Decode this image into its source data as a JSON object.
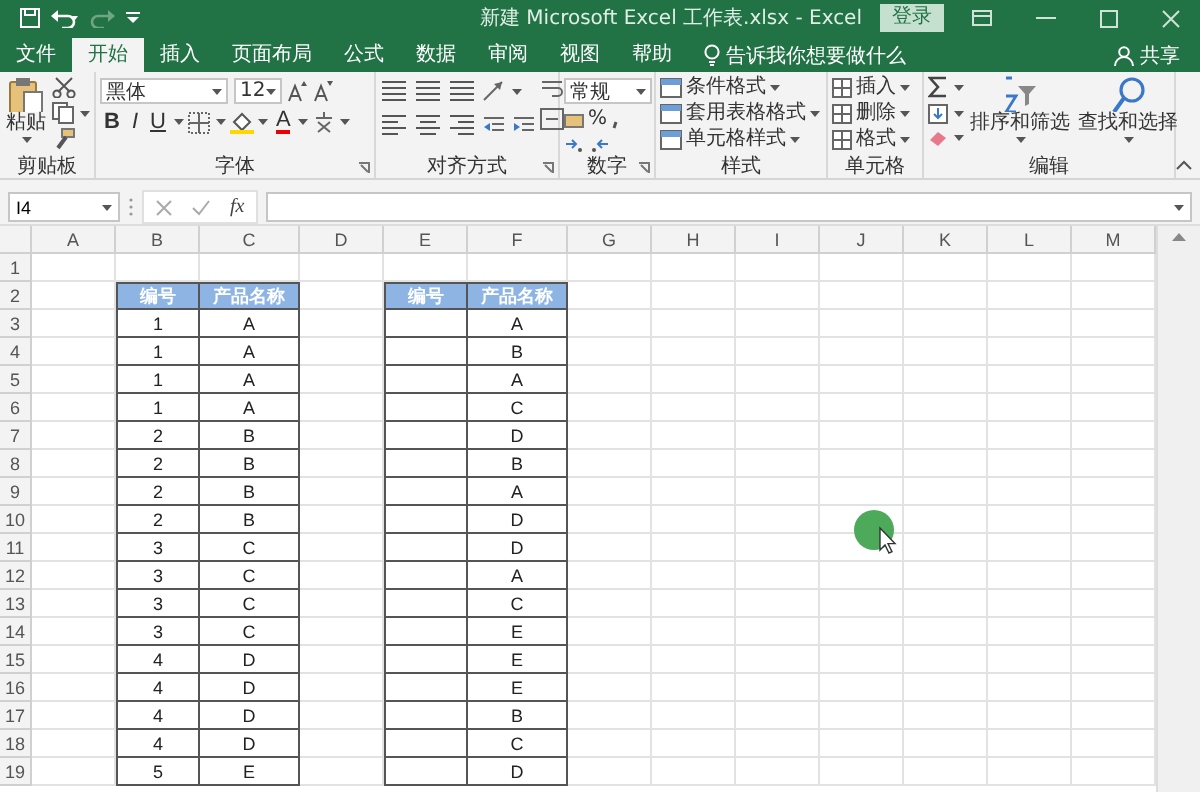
{
  "title_bar": {
    "title": "新建 Microsoft Excel 工作表.xlsx  -  Excel",
    "login_button": "登录"
  },
  "ribbon_tabs": [
    {
      "label": "文件",
      "selected": false
    },
    {
      "label": "开始",
      "selected": true
    },
    {
      "label": "插入",
      "selected": false
    },
    {
      "label": "页面布局",
      "selected": false
    },
    {
      "label": "公式",
      "selected": false
    },
    {
      "label": "数据",
      "selected": false
    },
    {
      "label": "审阅",
      "selected": false
    },
    {
      "label": "视图",
      "selected": false
    },
    {
      "label": "帮助",
      "selected": false
    }
  ],
  "tell_me": "告诉我你想要做什么",
  "share": "共享",
  "ribbon": {
    "clipboard": {
      "label": "剪贴板",
      "paste": "粘贴"
    },
    "font": {
      "label": "字体",
      "font_name": "黑体",
      "font_size": "12",
      "bold": "B",
      "italic": "I",
      "underline": "U",
      "font_color": "A"
    },
    "alignment": {
      "label": "对齐方式"
    },
    "number": {
      "label": "数字",
      "format": "常规",
      "percent": "%"
    },
    "styles": {
      "label": "样式",
      "items": [
        "条件格式",
        "套用表格格式",
        "单元格样式"
      ]
    },
    "cells": {
      "label": "单元格",
      "items": [
        "插入",
        "删除",
        "格式"
      ]
    },
    "editing": {
      "label": "编辑",
      "sort_filter": "排序和筛选",
      "find_select": "查找和选择"
    }
  },
  "formula_bar": {
    "name_box": "I4",
    "function_button": "fx"
  },
  "sheet": {
    "columns": [
      "A",
      "B",
      "C",
      "D",
      "E",
      "F",
      "G",
      "H",
      "I",
      "J",
      "K",
      "L",
      "M"
    ],
    "rows": [
      "1",
      "2",
      "3",
      "4",
      "5",
      "6",
      "7",
      "8",
      "9",
      "10",
      "11",
      "12",
      "13",
      "14",
      "15",
      "16",
      "17",
      "18",
      "19"
    ],
    "left_table": {
      "headers": [
        "编号",
        "产品名称"
      ],
      "rows": [
        [
          "1",
          "A"
        ],
        [
          "1",
          "A"
        ],
        [
          "1",
          "A"
        ],
        [
          "1",
          "A"
        ],
        [
          "2",
          "B"
        ],
        [
          "2",
          "B"
        ],
        [
          "2",
          "B"
        ],
        [
          "2",
          "B"
        ],
        [
          "3",
          "C"
        ],
        [
          "3",
          "C"
        ],
        [
          "3",
          "C"
        ],
        [
          "3",
          "C"
        ],
        [
          "4",
          "D"
        ],
        [
          "4",
          "D"
        ],
        [
          "4",
          "D"
        ],
        [
          "4",
          "D"
        ],
        [
          "5",
          "E"
        ]
      ]
    },
    "right_table": {
      "headers": [
        "编号",
        "产品名称"
      ],
      "product_names": [
        "A",
        "B",
        "A",
        "C",
        "D",
        "B",
        "A",
        "D",
        "D",
        "A",
        "C",
        "E",
        "E",
        "E",
        "B",
        "C",
        "D"
      ]
    }
  }
}
